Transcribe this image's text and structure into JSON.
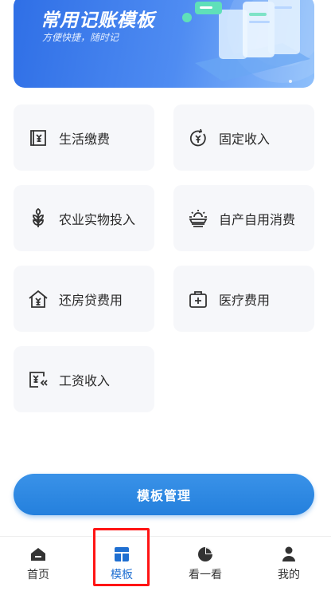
{
  "banner": {
    "title": "常用记账模板",
    "subtitle": "方便快捷，随时记"
  },
  "templates": [
    {
      "label": "生活缴费",
      "icon": "bill-icon"
    },
    {
      "label": "固定收入",
      "icon": "fixed-income-icon"
    },
    {
      "label": "农业实物投入",
      "icon": "wheat-icon"
    },
    {
      "label": "自产自用消费",
      "icon": "sun-farm-icon"
    },
    {
      "label": "还房贷费用",
      "icon": "house-loan-icon"
    },
    {
      "label": "医疗费用",
      "icon": "medical-kit-icon"
    },
    {
      "label": "工资收入",
      "icon": "salary-icon"
    }
  ],
  "manage_button": "模板管理",
  "tabbar": {
    "items": [
      {
        "label": "首页",
        "icon": "home-icon"
      },
      {
        "label": "模板",
        "icon": "template-icon"
      },
      {
        "label": "看一看",
        "icon": "pie-chart-icon"
      },
      {
        "label": "我的",
        "icon": "user-icon"
      }
    ],
    "active_index": 1
  },
  "colors": {
    "accent": "#2480dd",
    "active_tab": "#1f6fd1",
    "card_bg": "#f6f7fa",
    "highlight": "#ff1414"
  }
}
